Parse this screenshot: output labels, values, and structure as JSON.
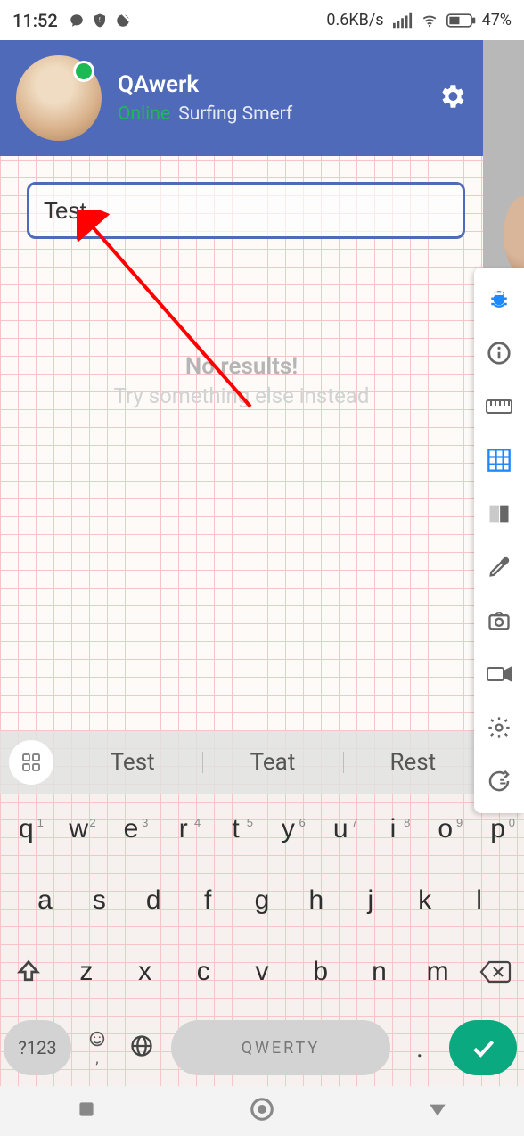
{
  "status": {
    "time": "11:52",
    "net": "0.6KB/s",
    "battery": "47%"
  },
  "header": {
    "name": "QAwerk",
    "online": "Online",
    "subtitle": "Surfing Smerf"
  },
  "search": {
    "value": "Test"
  },
  "empty": {
    "title": "No results!",
    "sub": "Try something else instead"
  },
  "suggestions": [
    "Test",
    "Teat",
    "Rest"
  ],
  "kbd": {
    "row1": [
      {
        "k": "q",
        "n": "1"
      },
      {
        "k": "w",
        "n": "2"
      },
      {
        "k": "e",
        "n": "3"
      },
      {
        "k": "r",
        "n": "4"
      },
      {
        "k": "t",
        "n": "5"
      },
      {
        "k": "y",
        "n": "6"
      },
      {
        "k": "u",
        "n": "7"
      },
      {
        "k": "i",
        "n": "8"
      },
      {
        "k": "o",
        "n": "9"
      },
      {
        "k": "p",
        "n": "0"
      }
    ],
    "row2": [
      "a",
      "s",
      "d",
      "f",
      "g",
      "h",
      "j",
      "k",
      "l"
    ],
    "row3": [
      "z",
      "x",
      "c",
      "v",
      "b",
      "n",
      "m"
    ],
    "sym": "?123",
    "space": "QWERTY",
    "period": "."
  }
}
